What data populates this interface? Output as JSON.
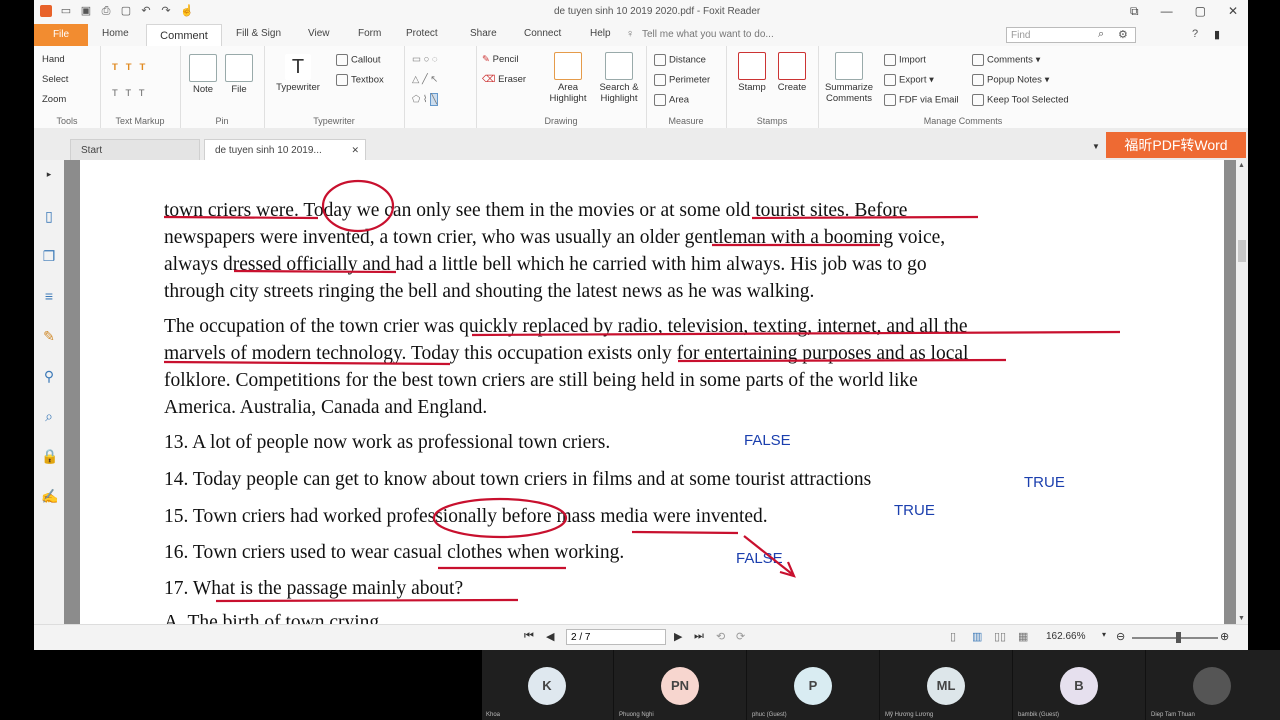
{
  "window": {
    "title": "de tuyen sinh 10 2019 2020.pdf - Foxit Reader"
  },
  "ribbon_tabs": [
    "File",
    "Home",
    "Comment",
    "Fill & Sign",
    "View",
    "Form",
    "Protect",
    "Share",
    "Connect",
    "Help"
  ],
  "tell_me": "Tell me what you want to do...",
  "find_placeholder": "Find",
  "groups": {
    "tools": {
      "label": "Tools",
      "items": [
        "Hand",
        "Select",
        "Zoom"
      ]
    },
    "text_markup": {
      "label": "Text Markup"
    },
    "pin": {
      "label": "Pin",
      "note": "Note",
      "file": "File"
    },
    "typewriter": {
      "label": "Typewriter",
      "typewriter": "Typewriter",
      "callout": "Callout",
      "textbox": "Textbox"
    },
    "drawing": {
      "label": "Drawing",
      "pencil": "Pencil",
      "eraser": "Eraser",
      "area_highlight": "Area Highlight",
      "search_highlight": "Search & Highlight"
    },
    "measure": {
      "label": "Measure",
      "items": [
        "Distance",
        "Perimeter",
        "Area"
      ]
    },
    "stamps": {
      "label": "Stamps",
      "stamp": "Stamp",
      "create": "Create"
    },
    "manage": {
      "label": "Manage Comments",
      "summarize": "Summarize Comments",
      "import": "Import",
      "export": "Export",
      "fdf": "FDF via Email",
      "comments": "Comments",
      "popup": "Popup Notes",
      "keep": "Keep Tool Selected"
    }
  },
  "doc_tabs": {
    "start": "Start",
    "current": "de tuyen sinh 10 2019..."
  },
  "banner": "福昕PDF转Word",
  "document": {
    "lines": [
      "town criers were. Today we can only see them in the movies or at some old tourist sites. Before",
      "newspapers were invented, a town crier, who was usually an older gentleman with a booming voice,",
      "always dressed officially and had a little bell which he carried with him always. His job was to go",
      "through city streets ringing the bell and shouting the latest news as he was walking.",
      "The occupation of the town crier was quickly replaced by radio, television, texting, internet, and all the",
      "marvels of modern technology. Today this occupation exists only for entertaining purposes and as local",
      "folklore. Competitions for the best town criers are still being held in some parts of the world like",
      "America. Australia, Canada and England.",
      "13. A lot of people now work as professional town criers.",
      "14. Today people can get to know about town criers in films and at some tourist attractions",
      "15. Town criers had worked professionally before mass media were invented.",
      "16. Town criers used to wear casual clothes when working.",
      "17. What is the passage mainly about?",
      "A. The birth of town crying"
    ],
    "answers": {
      "q13": "FALSE",
      "q14": "TRUE",
      "q15": "TRUE",
      "q16": "FALSE"
    }
  },
  "status": {
    "page": "2 / 7",
    "zoom": "162.66%"
  },
  "participants": [
    {
      "initials": "K",
      "name": "Khoa",
      "color": "#dfe8ef"
    },
    {
      "initials": "PN",
      "name": "Phuong Nghi",
      "color": "#f7d6cf"
    },
    {
      "initials": "P",
      "name": "phuc (Guest)",
      "color": "#d9ecf2"
    },
    {
      "initials": "ML",
      "name": "Mỹ Hương Lương",
      "color": "#dde6ea"
    },
    {
      "initials": "B",
      "name": "bambik (Guest)",
      "color": "#e6e0ee"
    },
    {
      "initials": "",
      "name": "Diep Tam Thuan",
      "color": "#555555"
    }
  ]
}
